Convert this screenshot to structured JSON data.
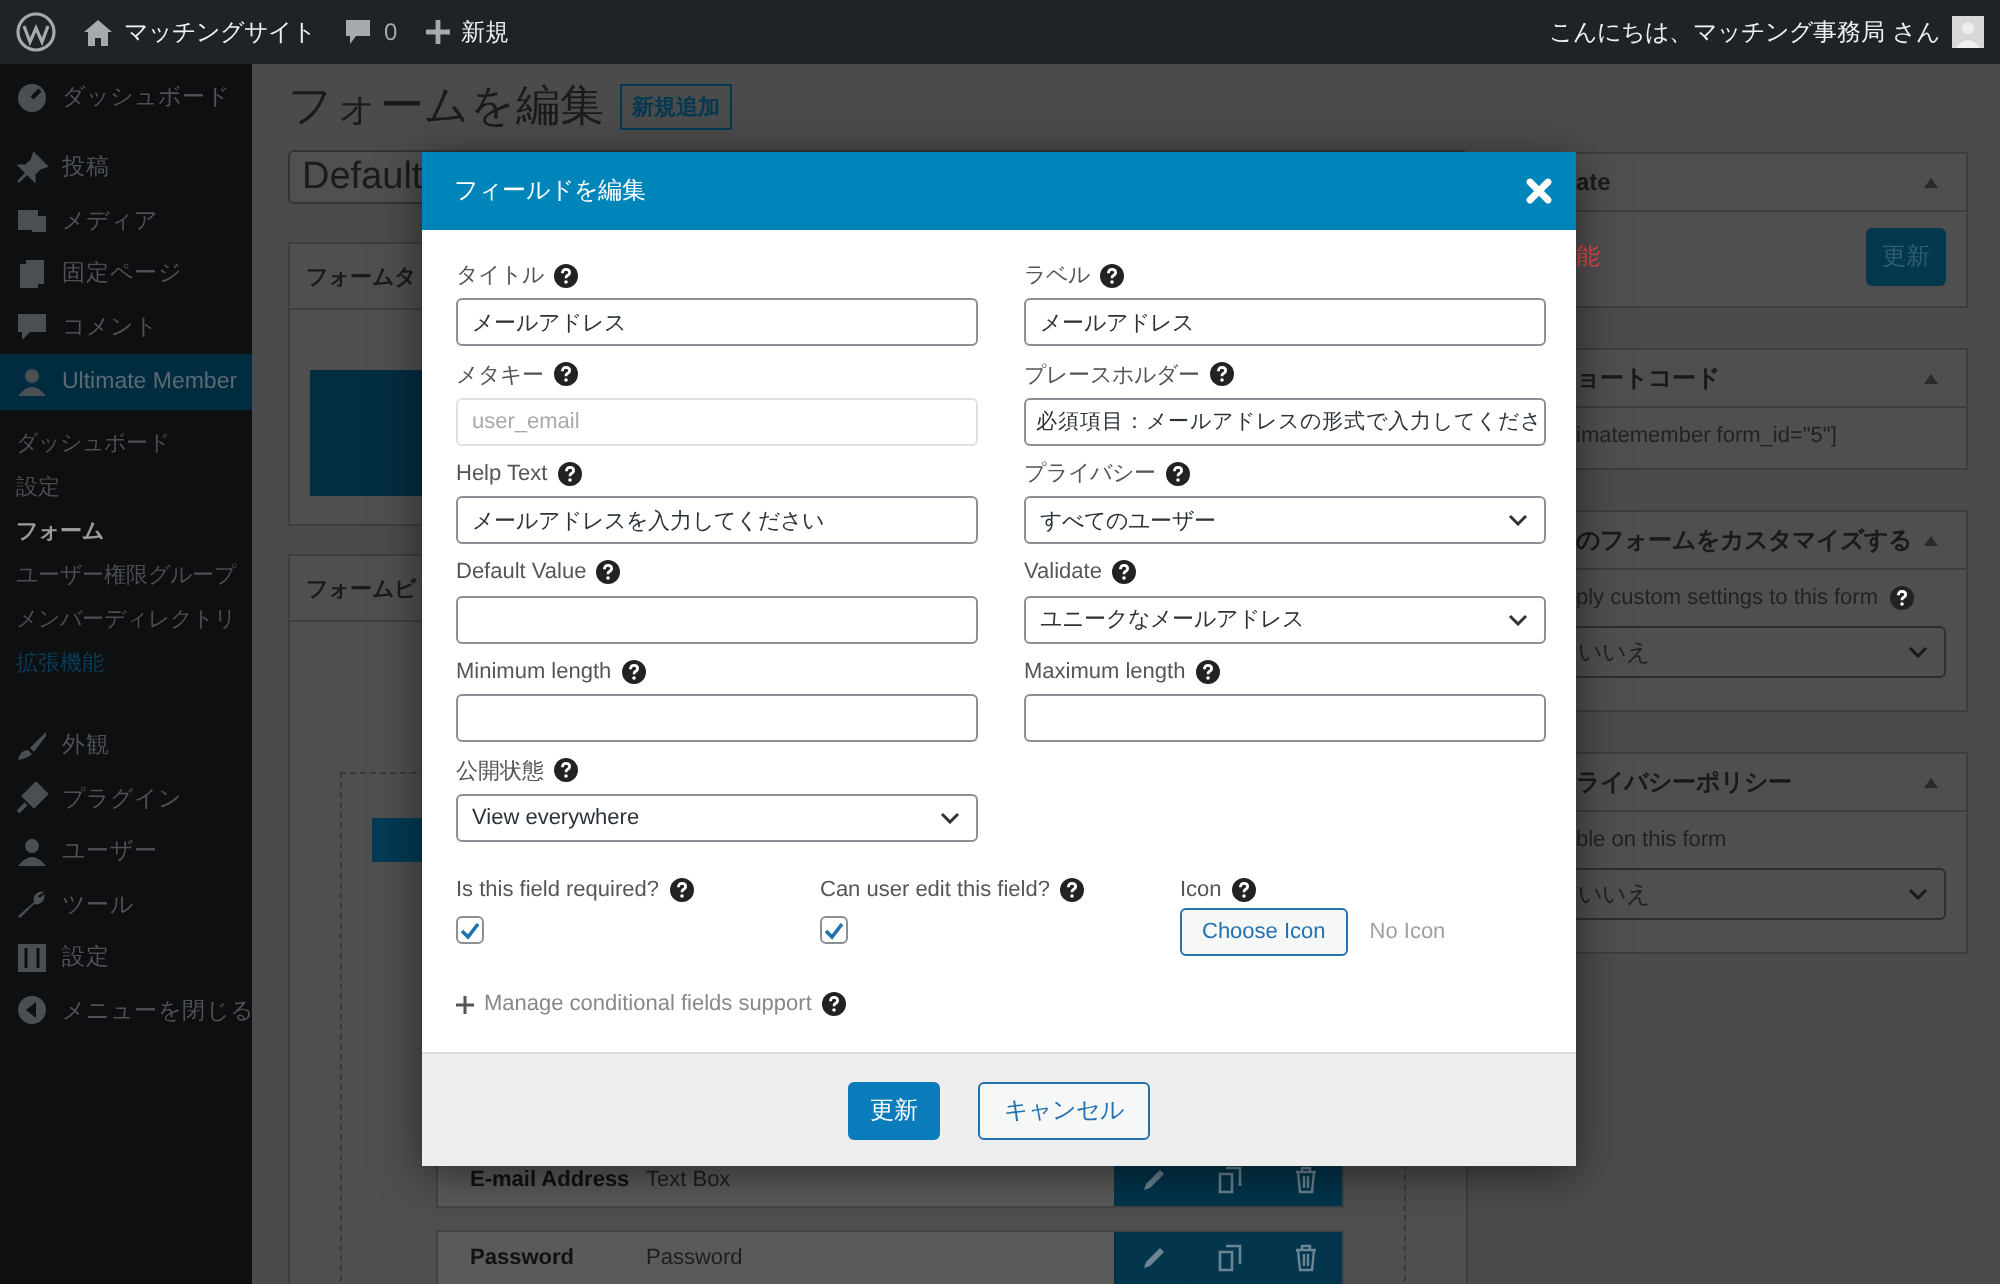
{
  "admin_bar": {
    "site_name": "マッチングサイト",
    "comments": "0",
    "new_label": "新規",
    "greeting": "こんにちは、マッチング事務局 さん"
  },
  "sidebar": {
    "groups": [
      [
        {
          "label": "ダッシュボード",
          "selected": false
        }
      ],
      [
        {
          "label": "投稿",
          "selected": false
        },
        {
          "label": "メディア",
          "selected": false
        },
        {
          "label": "固定ページ",
          "selected": false
        },
        {
          "label": "コメント",
          "selected": false
        },
        {
          "label": "Ultimate Member",
          "selected": true,
          "children": [
            {
              "label": "ダッシュボード",
              "selected": false,
              "kind": "plain"
            },
            {
              "label": "設定",
              "selected": false,
              "kind": "plain"
            },
            {
              "label": "フォーム",
              "selected": true,
              "kind": "plain"
            },
            {
              "label": "ユーザー権限グループ",
              "selected": false,
              "kind": "plain"
            },
            {
              "label": "メンバーディレクトリ",
              "selected": false,
              "kind": "plain"
            },
            {
              "label": "拡張機能",
              "selected": false,
              "kind": "accent"
            }
          ]
        }
      ],
      [
        {
          "label": "外観",
          "selected": false
        },
        {
          "label": "プラグイン",
          "selected": false
        },
        {
          "label": "ユーザー",
          "selected": false
        },
        {
          "label": "ツール",
          "selected": false
        },
        {
          "label": "設定",
          "selected": false
        },
        {
          "label": "メニューを閉じる",
          "selected": false
        }
      ]
    ]
  },
  "page": {
    "title": "フォームを編集",
    "add_new": "新規追加",
    "form_name": "Default",
    "panels": [
      {
        "title": "フォームタ"
      },
      {
        "title": "フォームビ"
      }
    ],
    "field_rows": [
      {
        "label": "E-mail Address",
        "type": "Text Box"
      },
      {
        "label": "Password",
        "type": "Password"
      }
    ]
  },
  "side_panels": [
    {
      "title": "ate",
      "status": "能",
      "button": "更新"
    },
    {
      "title": "ョートコード",
      "text": "imatemember form_id=\"5\"]",
      "help": false
    },
    {
      "title": "のフォームをカスタマイズする",
      "text": "ply custom settings to this form",
      "help": true,
      "select": "いいえ"
    },
    {
      "title": "ライバシーポリシー",
      "text": "ble on this form",
      "help": false,
      "select": "いいえ"
    }
  ],
  "modal": {
    "title": "フィールドを編集",
    "fields": [
      {
        "label": "タイトル",
        "kind": "text",
        "value": "メールアドレス",
        "disabled": false
      },
      {
        "label": "ラベル",
        "kind": "text",
        "value": "メールアドレス",
        "disabled": false
      },
      {
        "label": "メタキー",
        "kind": "text",
        "value": "user_email",
        "disabled": true
      },
      {
        "label": "プレースホルダー",
        "kind": "text",
        "value": "必須項目：メールアドレスの形式で入力してくださ",
        "disabled": false
      },
      {
        "label": "Help Text",
        "kind": "text",
        "value": "メールアドレスを入力してください",
        "disabled": false
      },
      {
        "label": "プライバシー",
        "kind": "select",
        "value": "すべてのユーザー"
      },
      {
        "label": "Default Value",
        "kind": "text",
        "disabled": false
      },
      {
        "label": "Validate",
        "kind": "select",
        "value": "ユニークなメールアドレス"
      },
      {
        "label": "Minimum length",
        "kind": "text",
        "disabled": false
      },
      {
        "label": "Maximum length",
        "kind": "text",
        "disabled": false
      },
      {
        "label": "公開状態",
        "kind": "select",
        "value": "View everywhere"
      }
    ],
    "options": [
      {
        "label": "Is this field required?",
        "kind": "checkbox",
        "checked": true
      },
      {
        "label": "Can user edit this field?",
        "kind": "checkbox",
        "checked": true
      },
      {
        "label": "Icon",
        "kind": "icon",
        "button": "Choose Icon",
        "value": "No Icon"
      }
    ],
    "conditional": "Manage conditional fields support",
    "buttons": [
      {
        "label": "更新",
        "kind": "primary"
      },
      {
        "label": "キャンセル",
        "kind": "secondary"
      }
    ]
  }
}
